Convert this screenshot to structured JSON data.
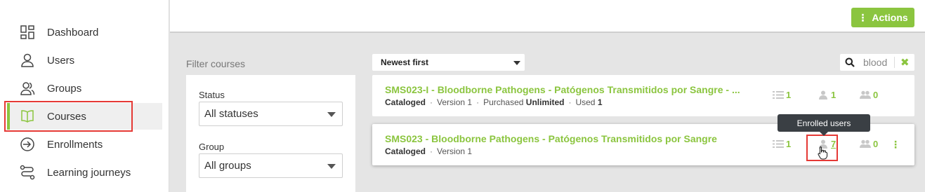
{
  "sidebar": {
    "items": [
      {
        "label": "Dashboard",
        "icon": "dashboard-icon",
        "active": false
      },
      {
        "label": "Users",
        "icon": "user-icon",
        "active": false
      },
      {
        "label": "Groups",
        "icon": "groups-icon",
        "active": false
      },
      {
        "label": "Courses",
        "icon": "book-icon",
        "active": true
      },
      {
        "label": "Enrollments",
        "icon": "enroll-icon",
        "active": false
      },
      {
        "label": "Learning journeys",
        "icon": "journey-icon",
        "active": false
      }
    ]
  },
  "topbar": {
    "actions_label": "Actions"
  },
  "filter": {
    "title": "Filter courses",
    "status_label": "Status",
    "status_value": "All statuses",
    "group_label": "Group",
    "group_value": "All groups"
  },
  "sort": {
    "value": "Newest first"
  },
  "search": {
    "value": "blood",
    "clear_symbol": "✖"
  },
  "courses": [
    {
      "title": "SMS023-I - Bloodborne Pathogens - Patógenos Transmitidos por Sangre - ...",
      "status": "Cataloged",
      "version": "Version 1",
      "purchased_label": "Purchased",
      "purchased_value": "Unlimited",
      "used_label": "Used",
      "used_value": "1",
      "lessons": "1",
      "enrolled": "1",
      "groups": "0"
    },
    {
      "title": "SMS023 - Bloodborne Pathogens - Patógenos Transmitidos por Sangre",
      "status": "Cataloged",
      "version": "Version 1",
      "lessons": "1",
      "enrolled": "7",
      "groups": "0"
    }
  ],
  "tooltip": {
    "text": "Enrolled users"
  },
  "colors": {
    "accent": "#8bc53f",
    "highlight": "#e53935",
    "tooltip_bg": "#3a3f44"
  }
}
